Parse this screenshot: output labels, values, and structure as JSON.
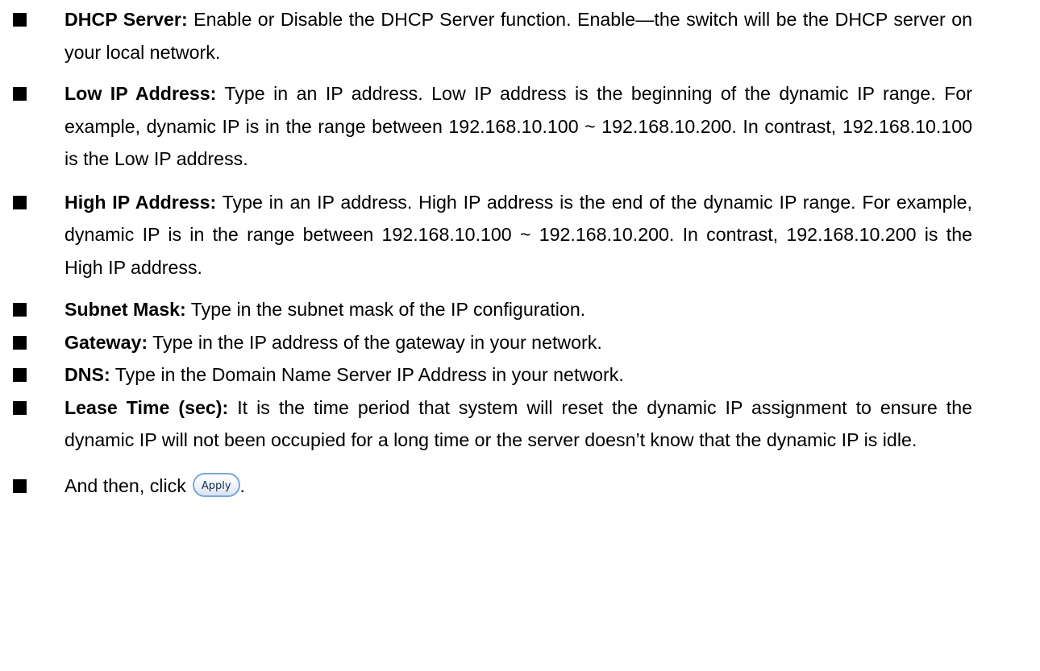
{
  "items": [
    {
      "term": "DHCP Server:",
      "text": " Enable or Disable the DHCP Server function. Enable—the switch will be the DHCP server on your local network."
    },
    {
      "term": "Low IP Address:",
      "text": " Type in an IP address. Low IP address is the beginning of the dynamic IP range. For example, dynamic IP is in the range between 192.168.10.100 ~ 192.168.10.200. In contrast, 192.168.10.100 is the Low IP address."
    },
    {
      "term": "High IP Address:",
      "text": " Type in an IP address. High IP address is the end of the dynamic IP range. For example, dynamic IP is in the range between 192.168.10.100 ~ 192.168.10.200. In contrast, 192.168.10.200 is the High IP address."
    },
    {
      "term": "Subnet Mask:",
      "text": " Type in the subnet mask of the IP configuration."
    },
    {
      "term": "Gateway:",
      "text": " Type in the IP address of the gateway in your network."
    },
    {
      "term": "DNS:",
      "text": " Type in the Domain Name Server IP Address in your network."
    },
    {
      "term": "Lease Time (sec):",
      "text": " It is the time period that system will reset the dynamic IP assignment to ensure the dynamic IP will not been occupied for a long time or the server doesn’t know that the dynamic IP is idle."
    }
  ],
  "final_step": {
    "text": "And then, click",
    "button_label": "Apply",
    "trailing": "."
  },
  "colors": {
    "text": "#000000",
    "button_border": "#7aa7d6"
  }
}
